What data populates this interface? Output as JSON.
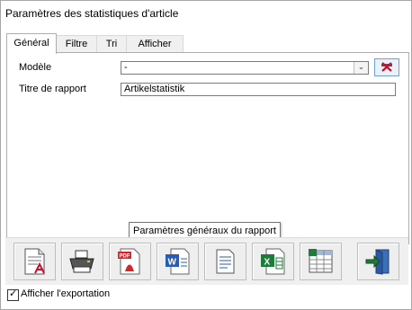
{
  "window": {
    "title": "Paramètres des statistiques d'article"
  },
  "tabs": [
    {
      "label": "Général",
      "active": true
    },
    {
      "label": "Filtre",
      "active": false
    },
    {
      "label": "Tri",
      "active": false
    },
    {
      "label": "Afficher",
      "active": false
    }
  ],
  "form": {
    "model_label": "Modèle",
    "model_value": "-",
    "report_title_label": "Titre de rapport",
    "report_title_value": "Artikelstatistik"
  },
  "tooltip": "Paramètres généraux du rapport",
  "toolbar": {
    "buttons": [
      {
        "name": "preview-report-icon"
      },
      {
        "name": "printer-icon"
      },
      {
        "name": "pdf-icon"
      },
      {
        "name": "word-icon"
      },
      {
        "name": "text-document-icon"
      },
      {
        "name": "excel-icon"
      },
      {
        "name": "spreadsheet-grid-icon"
      },
      {
        "name": "exit-door-icon"
      }
    ]
  },
  "export": {
    "show_export_label": "Afficher l'exportation",
    "checked": true
  },
  "colors": {
    "accent": "#1f6fd0",
    "pdf_red": "#d7262b",
    "excel_green": "#1e7b3a",
    "word_blue": "#2a5db0"
  }
}
